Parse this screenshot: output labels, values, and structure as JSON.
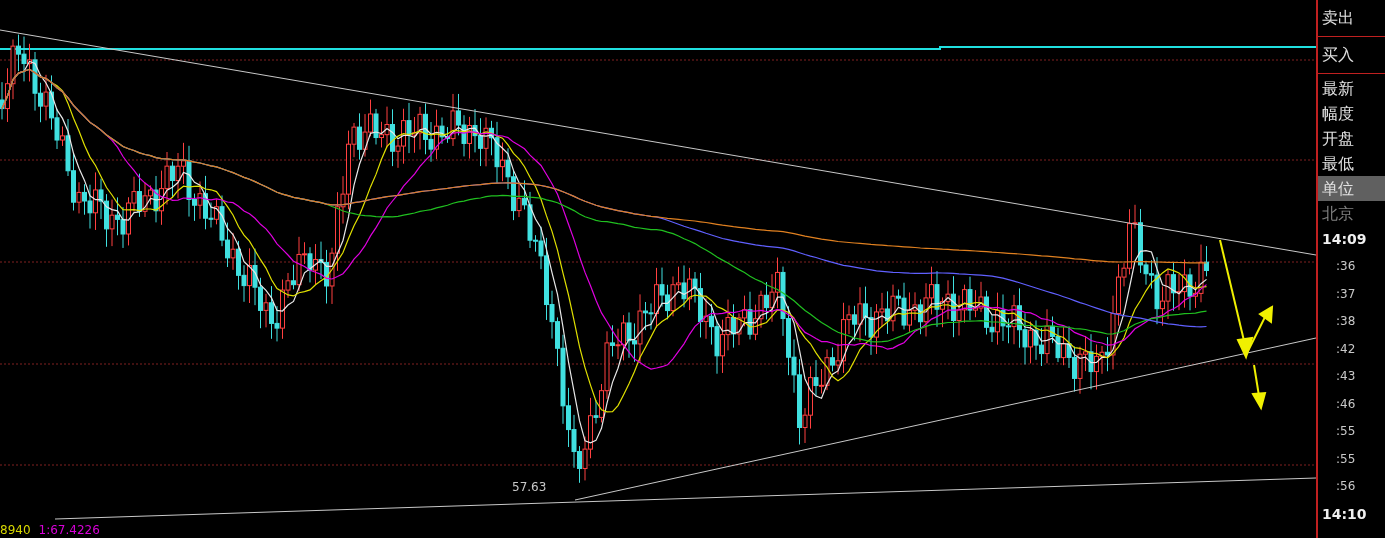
{
  "chart": {
    "low_label": "57.63"
  },
  "side_panel": {
    "trade_buttons": [
      {
        "label": "卖出"
      },
      {
        "label": "买入"
      }
    ],
    "fields": [
      {
        "label": "最新",
        "selected": false,
        "dimmed": false
      },
      {
        "label": "幅度",
        "selected": false,
        "dimmed": false
      },
      {
        "label": "开盘",
        "selected": false,
        "dimmed": false
      },
      {
        "label": "最低",
        "selected": false,
        "dimmed": false
      },
      {
        "label": "单位",
        "selected": true,
        "dimmed": false
      },
      {
        "label": "北京",
        "selected": false,
        "dimmed": true
      }
    ],
    "times": [
      {
        "text": "14:09",
        "kind": "minute"
      },
      {
        "text": ":36",
        "kind": "second"
      },
      {
        "text": ":37",
        "kind": "second"
      },
      {
        "text": ":38",
        "kind": "second"
      },
      {
        "text": ":42",
        "kind": "second"
      },
      {
        "text": ":43",
        "kind": "second"
      },
      {
        "text": ":46",
        "kind": "second"
      },
      {
        "text": ":55",
        "kind": "second"
      },
      {
        "text": ":55",
        "kind": "second"
      },
      {
        "text": ":56",
        "kind": "second"
      },
      {
        "text": "14:10",
        "kind": "minute"
      }
    ]
  },
  "footer": {
    "values": [
      {
        "text": "8940",
        "color": "#d8d800"
      },
      {
        "text": "1:67.4226",
        "color": "#d800d8"
      }
    ]
  }
}
